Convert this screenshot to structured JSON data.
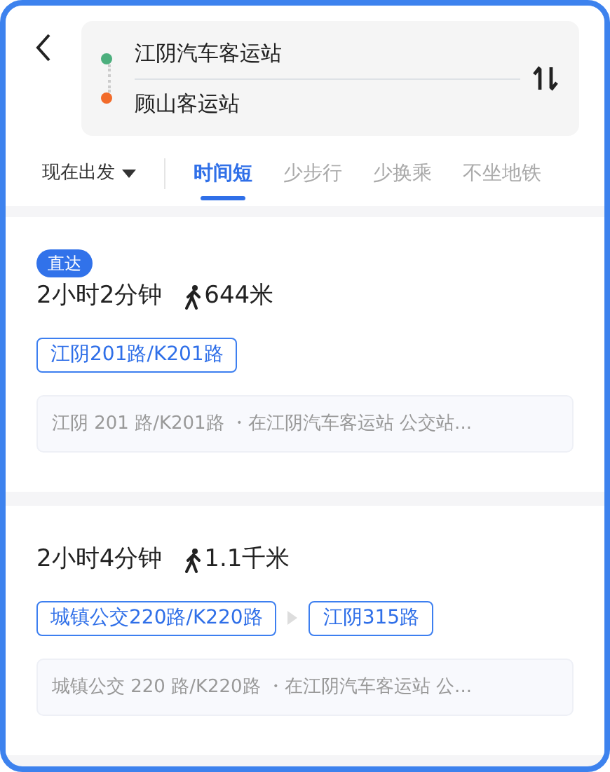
{
  "header": {
    "origin": {
      "name": "江阴汽车客运站",
      "color": "#4caf7d"
    },
    "destination": {
      "name": "顾山客运站",
      "color": "#f26b2a"
    }
  },
  "filters": {
    "depart": "现在出发",
    "tabs": [
      {
        "label": "时间短",
        "selected": true
      },
      {
        "label": "少步行",
        "selected": false
      },
      {
        "label": "少换乘",
        "selected": false
      },
      {
        "label": "不坐地铁",
        "selected": false
      }
    ]
  },
  "routes": [
    {
      "badge": "直达",
      "duration": "2小时2分钟",
      "walk": "644米",
      "lines": [
        "江阴201路/K201路"
      ],
      "summary": {
        "route": "江阴 201 路/K201路",
        "detail": "・在江阴汽车客运站 公交站..."
      }
    },
    {
      "duration": "2小时4分钟",
      "walk": "1.1千米",
      "lines": [
        "城镇公交220路/K220路",
        "江阴315路"
      ],
      "summary": {
        "route": "城镇公交 220 路/K220路",
        "detail": "・在江阴汽车客运站 公..."
      }
    }
  ]
}
